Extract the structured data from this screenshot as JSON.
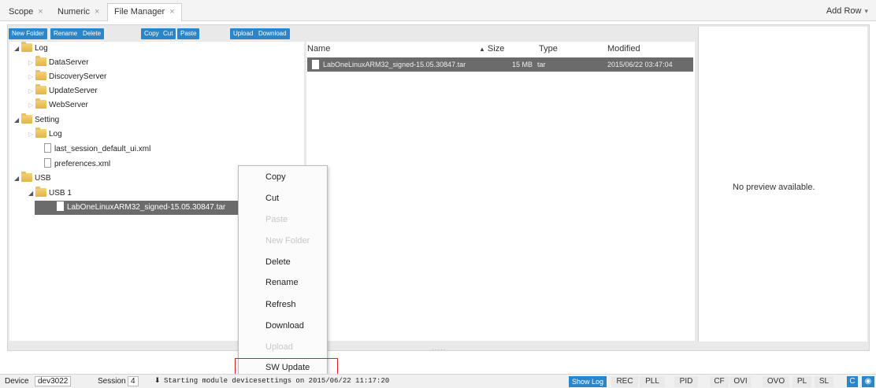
{
  "tabs": [
    {
      "label": "Scope",
      "close": "×"
    },
    {
      "label": "Numeric",
      "close": "×"
    },
    {
      "label": "File Manager",
      "close": "×"
    }
  ],
  "add_row": {
    "label": "Add Row",
    "icon": "chevron-down-icon"
  },
  "toolbar": {
    "new_folder": "New Folder",
    "rename": "Rename",
    "delete": "Delete",
    "copy": "Copy",
    "cut": "Cut",
    "paste": "Paste",
    "upload": "Upload",
    "download": "Download"
  },
  "tree": {
    "log": "Log",
    "data_server": "DataServer",
    "discovery_server": "DiscoveryServer",
    "update_server": "UpdateServer",
    "web_server": "WebServer",
    "setting": "Setting",
    "setting_log": "Log",
    "last_session": "last_session_default_ui.xml",
    "preferences": "preferences.xml",
    "usb": "USB",
    "usb1": "USB 1",
    "selected_file": "LabOneLinuxARM32_signed-15.05.30847.tar"
  },
  "list": {
    "headers": {
      "name": "Name",
      "size": "Size",
      "type": "Type",
      "modified": "Modified"
    },
    "rows": [
      {
        "name": "LabOneLinuxARM32_signed-15.05.30847.tar",
        "size": "15 MB",
        "type": "tar",
        "modified": "2015/06/22 03:47:04"
      }
    ]
  },
  "preview": {
    "message": "No preview available."
  },
  "context_menu": {
    "copy": "Copy",
    "cut": "Cut",
    "paste": "Paste",
    "new_folder": "New Folder",
    "delete": "Delete",
    "rename": "Rename",
    "refresh": "Refresh",
    "download": "Download",
    "upload": "Upload",
    "sw_update": "SW Update"
  },
  "status": {
    "device_label": "Device",
    "device_value": "dev3022",
    "session_label": "Session",
    "session_value": "4",
    "log_message": "Starting module devicesettings on 2015/06/22 11:17:20",
    "show_log": "Show Log",
    "indicators": [
      "REC",
      "PLL",
      "PID",
      "CF",
      "OVI",
      "OVO",
      "PL",
      "SL",
      "C"
    ]
  },
  "colors": {
    "accent": "#2a86c8",
    "selection": "#6b6b6b",
    "highlight_box": "#d81f26"
  }
}
